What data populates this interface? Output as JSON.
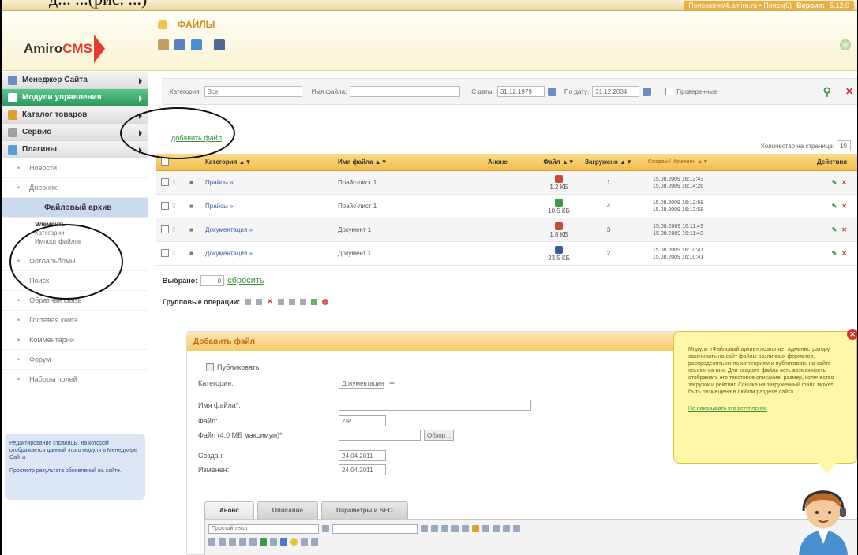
{
  "caption": "д...                                       ...(рис. ...)",
  "topbar": {
    "site": "Поисковик/4.amiro.ru • Поиск(0)",
    "version_label": "Версия:",
    "version": "5.12.0"
  },
  "header": {
    "logo_a": "Amiro",
    "logo_b": "CMS",
    "title": "ФАЙЛЫ"
  },
  "sidebar": {
    "main": [
      {
        "label": "Менеджер Сайта"
      },
      {
        "label": "Модули управления"
      },
      {
        "label": "Каталог товаров"
      },
      {
        "label": "Сервис"
      },
      {
        "label": "Плагины"
      }
    ],
    "subs_top": [
      "Новости",
      "Дневник"
    ],
    "active": "Файловый архив",
    "subs3": [
      "Элементы",
      "Категории",
      "Импорт файлов"
    ],
    "subs_bottom": [
      "Фотоальбомы",
      "Поиск",
      "Обратная связь",
      "Гостевая книга",
      "Комментарии",
      "Форум",
      "Наборы полей"
    ],
    "info_1": "Редактирование страницы, на которой отображается данный этого модуля в Менеджере Сайта",
    "info_2": "Просмотр результата обновлений на сайте."
  },
  "filter": {
    "category_label": "Категория:",
    "category_value": "Все",
    "name_label": "Имя файла:",
    "name_value": "",
    "from_label": "С даты:",
    "from_value": "31.12.1979",
    "to_label": "По дату:",
    "to_value": "31.12.2034",
    "checkbox_label": "Проверенные"
  },
  "add_file": "добавить файл",
  "per_page": {
    "label": "Количество на странице:",
    "value": "10"
  },
  "table": {
    "headers": [
      "",
      "",
      "",
      "Категория ▲▼",
      "Имя файла ▲▼",
      "Анонс",
      "Файл ▲▼",
      "Загружено ▲▼",
      "Создан / Изменен ▲▼",
      "Действия"
    ],
    "rows": [
      {
        "category": "Прайсы »",
        "name": "Прайс-лист 1",
        "size": "1.2 КБ",
        "downloads": "1",
        "dates": "15.08.2009 16:13:43\n15.08.2009 16:14:26",
        "icon": "r"
      },
      {
        "category": "Прайсы »",
        "name": "Прайс-лист 1",
        "size": "10.5 КБ",
        "downloads": "4",
        "dates": "15.08.2009 16:12:58\n15.08.2009 16:12:58",
        "icon": "g"
      },
      {
        "category": "Документация »",
        "name": "Документ 1",
        "size": "1.8 КБ",
        "downloads": "3",
        "dates": "15.08.2009 16:11:43\n15.08.2009 16:11:43",
        "icon": "r"
      },
      {
        "category": "Документация »",
        "name": "Документ 1",
        "size": "23.5 КБ",
        "downloads": "2",
        "dates": "15.08.2009 16:10:41\n15.08.2009 16:10:41",
        "icon": "b"
      }
    ]
  },
  "selected": {
    "label": "Выбрано:",
    "count": "0",
    "reset": "сбросить"
  },
  "group_ops": "Групповые операции:",
  "form": {
    "title": "Добавить файл",
    "publish": "Публиковать",
    "category_label": "Категория:",
    "category_value": "Документация",
    "name_label": "Имя файла*:",
    "file_label": "Файл:",
    "file_value": "ZIP",
    "upload_label": "Файл (4.0 МБ максимум)*:",
    "browse": "Обзор...",
    "created_label": "Создан:",
    "created_value": "24.04.2011",
    "changed_label": "Изменен:",
    "changed_value": "24.04.2011",
    "tabs": [
      "Анонс",
      "Описание",
      "Параметры и SEO"
    ],
    "style_value": "Простой текст"
  },
  "tip": {
    "text": "Модуль «Файловый архив» позволяет администратору закачивать на сайт файлы различных форматов, распределять их по категориям и публиковать на сайте ссылки на них. Для каждого файла есть возможность отображать его текстовое описание, размер, количество загрузок и рейтинг. Ссылка на загруженный файл может быть размещена в любом разделе сайта.",
    "link": "Не показывать это вступление"
  }
}
